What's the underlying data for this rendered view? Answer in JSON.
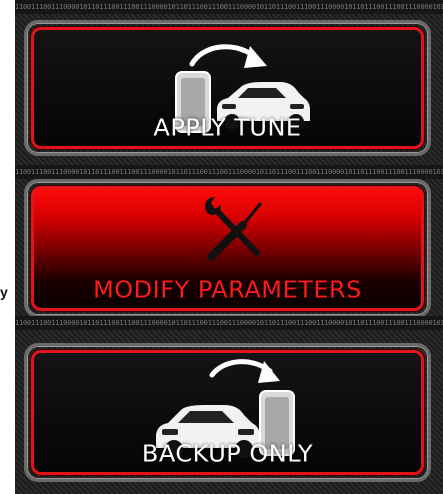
{
  "side_text": "y",
  "binary_strip": "1100111001110000101101110011100111000010110111001110011100001011011100111001110000101101110011100111000010110111001110011100001011011100111001110000101101110011",
  "buttons": [
    {
      "id": "apply",
      "label": "APPLY TUNE",
      "icon": "device-to-car-icon",
      "active": false
    },
    {
      "id": "modify",
      "label": "MODIFY PARAMETERS",
      "icon": "wrench-screwdriver-icon",
      "active": true
    },
    {
      "id": "backup",
      "label": "BACKUP ONLY",
      "icon": "car-to-device-icon",
      "active": false
    }
  ],
  "colors": {
    "accent_red": "#e0141c",
    "active_red": "#ff1a1a",
    "panel_dark": "#1c1c1c",
    "label_white": "#ffffff"
  }
}
